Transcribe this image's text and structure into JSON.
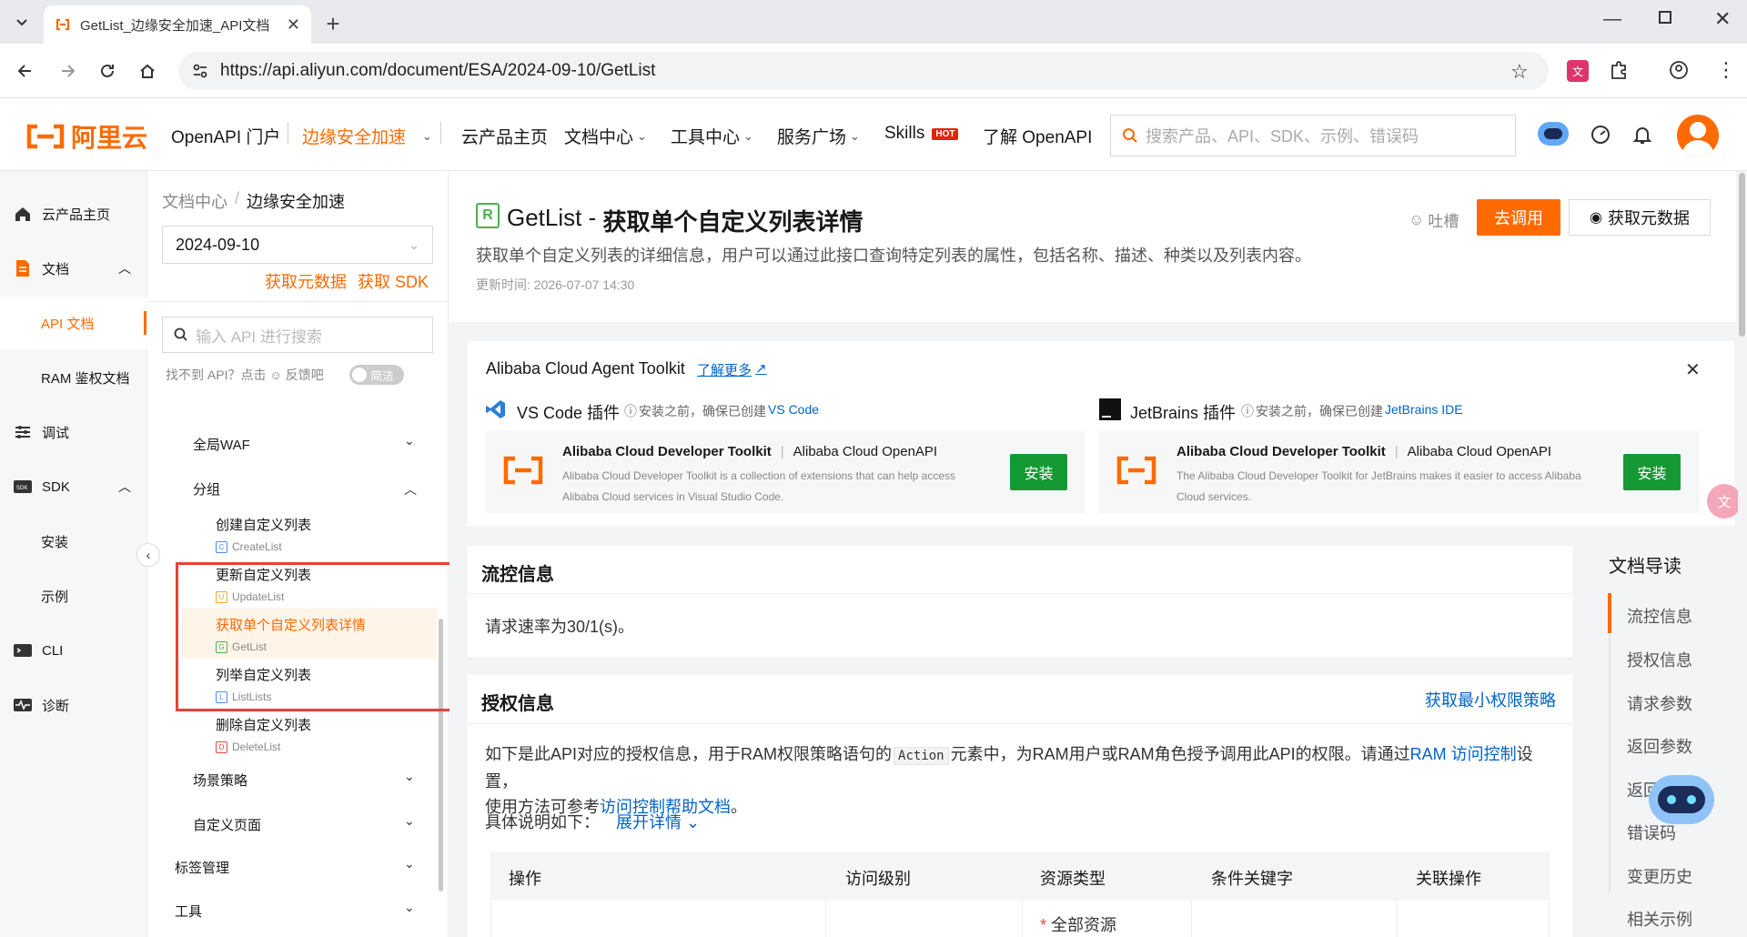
{
  "browser": {
    "tab_title": "GetList_边缘安全加速_API文档",
    "url": "https://api.aliyun.com/document/ESA/2024-09-10/GetList"
  },
  "header": {
    "logo_text": "阿里云",
    "portal": "OpenAPI 门户",
    "product": "边缘安全加速",
    "nav": [
      "云产品主页",
      "文档中心",
      "工具中心",
      "服务广场",
      "Skills",
      "了解 OpenAPI"
    ],
    "hot_badge": "HOT",
    "search_placeholder": "搜索产品、API、SDK、示例、错误码"
  },
  "rail": {
    "items": [
      "云产品主页",
      "文档",
      "API 文档",
      "RAM 鉴权文档",
      "调试",
      "SDK",
      "安装",
      "示例",
      "CLI",
      "诊断"
    ]
  },
  "tree": {
    "breadcrumb_root": "文档中心",
    "breadcrumb_sep": "/",
    "breadcrumb_current": "边缘安全加速",
    "version": "2024-09-10",
    "link_metadata": "获取元数据",
    "link_sdk": "获取 SDK",
    "search_placeholder": "输入 API 进行搜索",
    "feedback_text": "找不到 API？点击",
    "feedback_link": "反馈吧",
    "toggle_label": "简洁",
    "groups": [
      "全局WAF",
      "分组",
      "场景策略",
      "自定义页面",
      "标签管理",
      "工具"
    ],
    "apis": [
      {
        "zh": "创建自定义列表",
        "en": "CreateList",
        "badge": "C"
      },
      {
        "zh": "更新自定义列表",
        "en": "UpdateList",
        "badge": "U"
      },
      {
        "zh": "获取单个自定义列表详情",
        "en": "GetList",
        "badge": "G"
      },
      {
        "zh": "列举自定义列表",
        "en": "ListLists",
        "badge": "L"
      },
      {
        "zh": "删除自定义列表",
        "en": "DeleteList",
        "badge": "D"
      }
    ]
  },
  "page": {
    "api_name": "GetList",
    "title_sep": " - ",
    "title_zh": "获取单个自定义列表详情",
    "description": "获取单个自定义列表的详细信息，用户可以通过此接口查询特定列表的属性，包括名称、描述、种类以及列表内容。",
    "updated": "更新时间: 2026-07-07 14:30",
    "feedback": "吐槽",
    "btn_call": "去调用",
    "btn_metadata": "获取元数据"
  },
  "toolkit": {
    "title": "Alibaba Cloud Agent Toolkit",
    "learn_more": "了解更多",
    "vscode": {
      "label": "VS Code 插件",
      "note": "安装之前，确保已创建",
      "note_link": "VS Code",
      "name": "Alibaba Cloud Developer Toolkit",
      "sep": "|",
      "product": "Alibaba Cloud OpenAPI",
      "desc": "Alibaba Cloud Developer Toolkit is a collection of extensions that can help access Alibaba Cloud services in Visual Studio Code.",
      "install": "安装"
    },
    "jetbrains": {
      "label": "JetBrains 插件",
      "note": "安装之前，确保已创建",
      "note_link": "JetBrains IDE",
      "name": "Alibaba Cloud Developer Toolkit",
      "sep": "|",
      "product": "Alibaba Cloud OpenAPI",
      "desc": "The Alibaba Cloud Developer Toolkit for JetBrains makes it easier to access Alibaba Cloud services.",
      "install": "安装"
    }
  },
  "flow": {
    "title": "流控信息",
    "text": "请求速率为30/1(s)。"
  },
  "auth": {
    "title": "授权信息",
    "policy_link": "获取最小权限策略",
    "p1_a": "如下是此API对应的授权信息，用于RAM权限策略语句的",
    "code": "Action",
    "p1_b": "元素中，为RAM用户或RAM角色授予调用此API的权限。请通过",
    "ram_link": "RAM 访问控制",
    "p1_c": "设置，",
    "p2_a": "使用方法可参考",
    "help_link": "访问控制帮助文档",
    "p2_b": "。",
    "detail_label": "具体说明如下：",
    "expand_link": "展开详情",
    "columns": [
      "操作",
      "访问级别",
      "资源类型",
      "条件关键字",
      "关联操作"
    ],
    "row_resource": "全部资源",
    "row_required": "*"
  },
  "toc": {
    "title": "文档导读",
    "items": [
      "流控信息",
      "授权信息",
      "请求参数",
      "返回参数",
      "返回示例",
      "错误码",
      "变更历史",
      "相关示例"
    ]
  },
  "colors": {
    "accent": "#ff6a00",
    "link": "#0064c8",
    "highlight_box": "#e8413b",
    "selected_bg": "#fff4e8"
  }
}
